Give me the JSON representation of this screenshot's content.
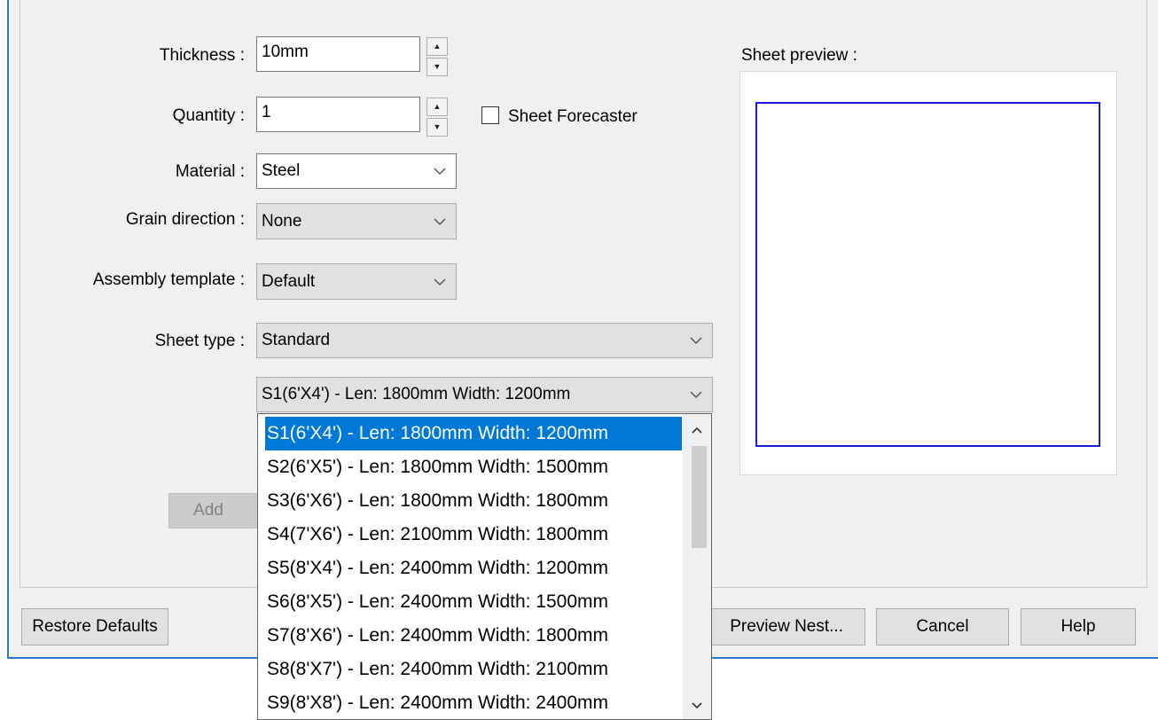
{
  "form": {
    "thickness": {
      "label": "Thickness :",
      "value": "10mm"
    },
    "quantity": {
      "label": "Quantity :",
      "value": "1"
    },
    "sheet_forecaster": {
      "label": "Sheet Forecaster",
      "checked": false
    },
    "material": {
      "label": "Material :",
      "value": "Steel"
    },
    "grain_direction": {
      "label": "Grain direction :",
      "value": "None"
    },
    "assembly_template": {
      "label": "Assembly template :",
      "value": "Default"
    },
    "sheet_type": {
      "label": "Sheet type :",
      "value": "Standard"
    },
    "sheet_size": {
      "value": "S1(6'X4') - Len: 1800mm Width: 1200mm"
    },
    "add_button": "Add"
  },
  "preview": {
    "label": "Sheet preview :",
    "border_color": "#1c1cd8"
  },
  "dropdown": {
    "selected_index": 0,
    "selected_color": "#0078d7",
    "items": [
      "S1(6'X4') - Len: 1800mm Width: 1200mm",
      "S2(6'X5') - Len: 1800mm Width: 1500mm",
      "S3(6'X6') - Len: 1800mm Width: 1800mm",
      "S4(7'X6') - Len: 2100mm Width: 1800mm",
      "S5(8'X4') - Len: 2400mm Width: 1200mm",
      "S6(8'X5') - Len: 2400mm Width: 1500mm",
      "S7(8'X6') - Len: 2400mm Width: 1800mm",
      "S8(8'X7') - Len: 2400mm Width: 2100mm",
      "S9(8'X8') - Len: 2400mm Width: 2400mm"
    ]
  },
  "footer": {
    "restore_defaults": "Restore Defaults",
    "preview_nest": "Preview Nest...",
    "cancel": "Cancel",
    "help": "Help"
  },
  "icons": {
    "spin_up": "spin-up-icon",
    "spin_down": "spin-down-icon",
    "chevron": "chevron-down-icon"
  }
}
